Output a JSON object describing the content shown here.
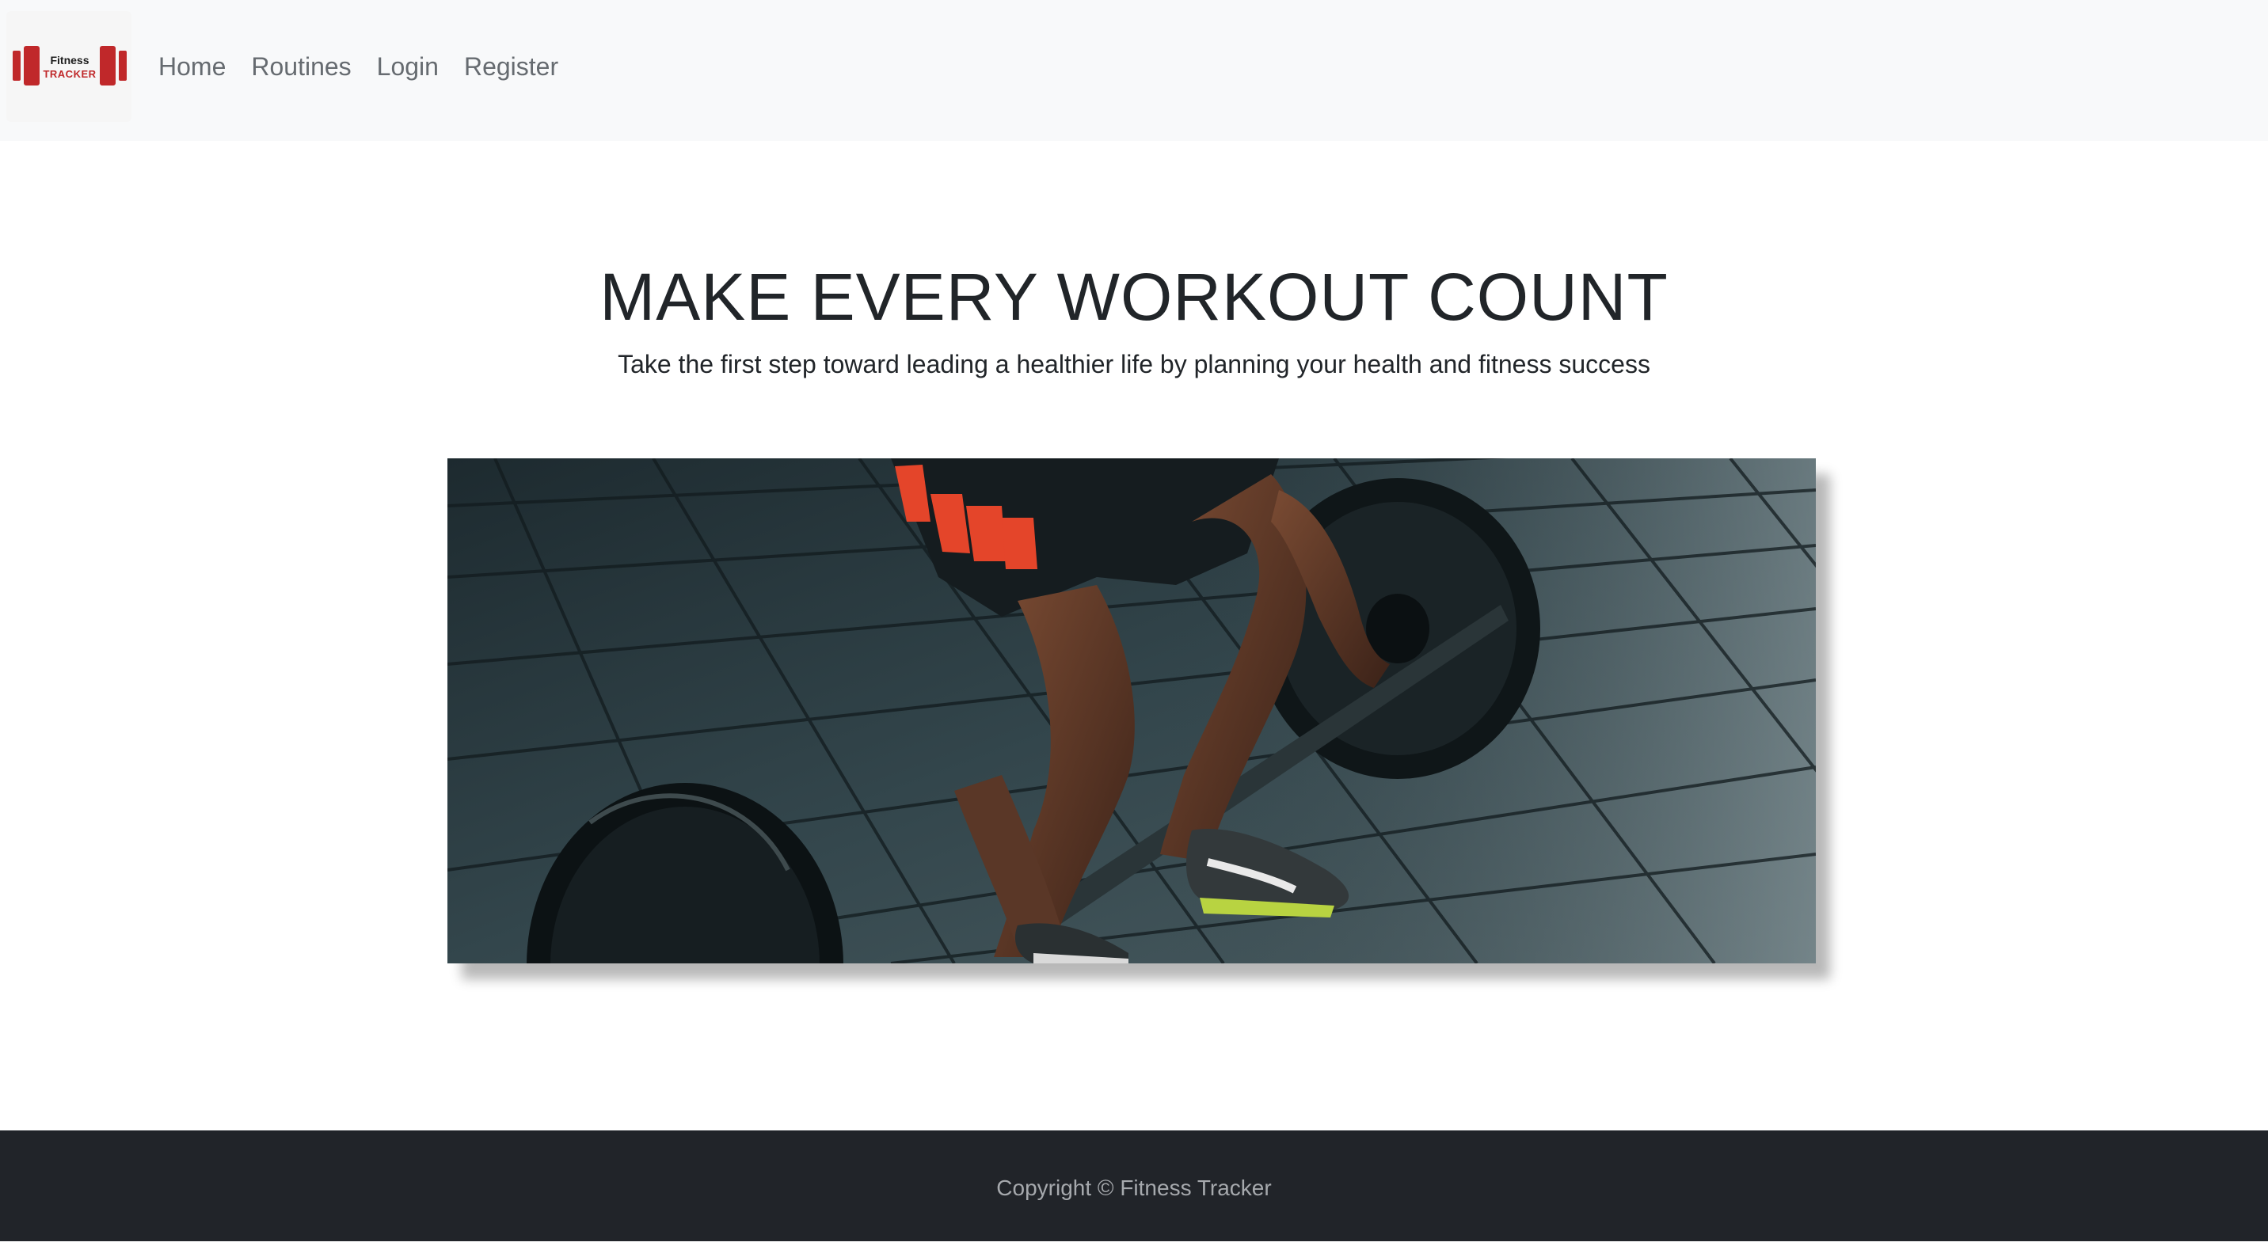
{
  "nav": {
    "brand": {
      "line1": "Fitness",
      "line2": "TRACKER",
      "color": "#c0282a"
    },
    "links": [
      {
        "label": "Home"
      },
      {
        "label": "Routines"
      },
      {
        "label": "Login"
      },
      {
        "label": "Register"
      }
    ]
  },
  "hero": {
    "title": "MAKE EVERY WORKOUT COUNT",
    "subtitle": "Take the first step toward leading a healthier life by planning your health and fitness success"
  },
  "footer": {
    "copyright": "Copyright © Fitness Tracker"
  },
  "colors": {
    "navbar_bg": "#f8f9fa",
    "footer_bg": "#212429",
    "text_dark": "#212529",
    "nav_text": "#666b70",
    "brand_red": "#c0282a"
  }
}
